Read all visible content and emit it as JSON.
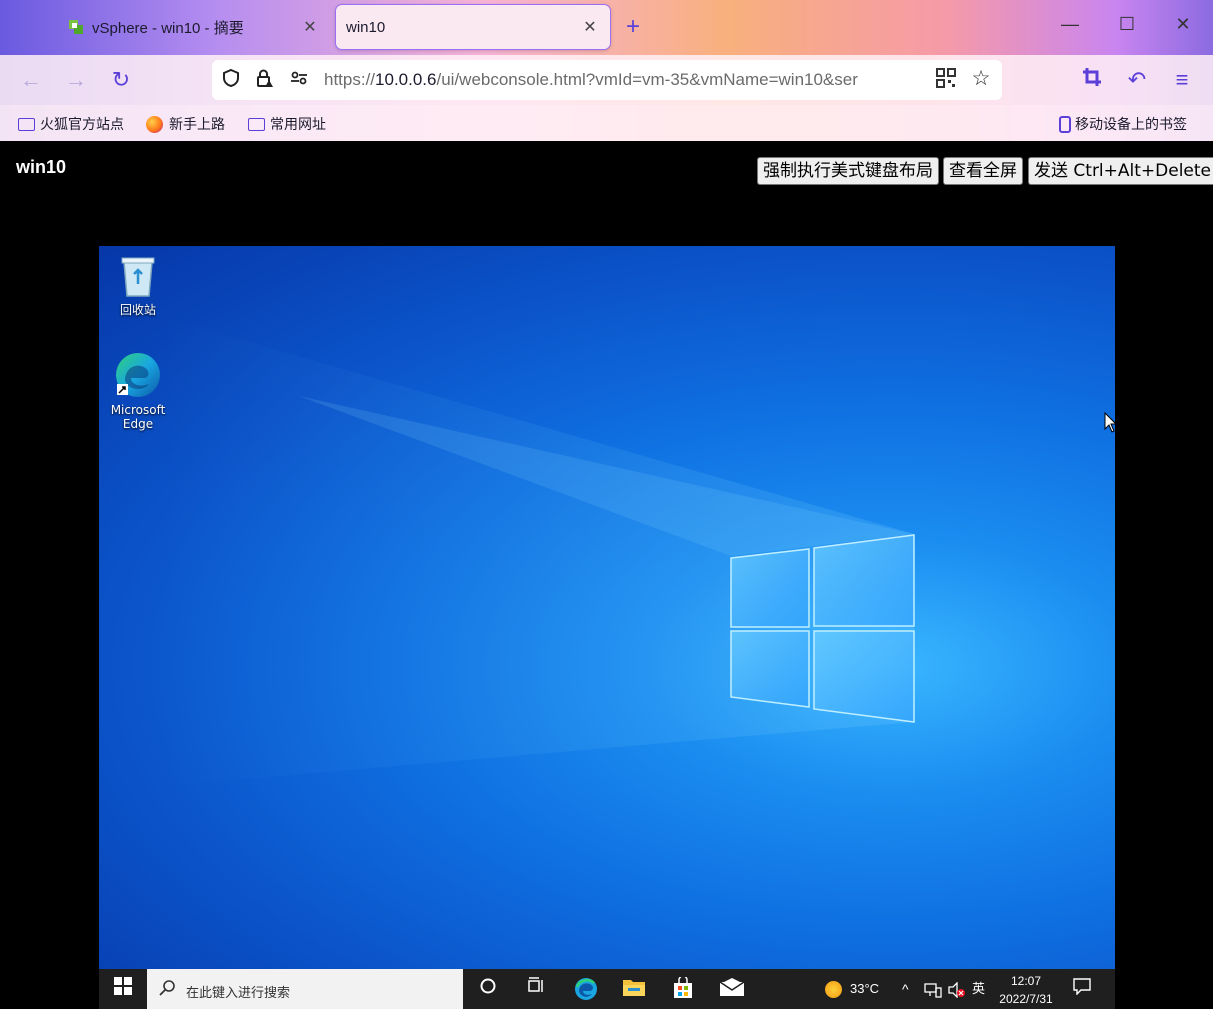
{
  "browser": {
    "tabs": [
      {
        "label": "vSphere - win10 - 摘要",
        "active": false
      },
      {
        "label": "win10",
        "active": true
      }
    ],
    "url": {
      "prefix": "https://",
      "host": "10.0.0.6",
      "path": "/ui/webconsole.html?vmId=vm-35&vmName=win10&ser"
    },
    "bookmarks": [
      {
        "label": "火狐官方站点",
        "icon": "folder-icon"
      },
      {
        "label": "新手上路",
        "icon": "firefox-icon"
      },
      {
        "label": "常用网址",
        "icon": "folder-icon"
      }
    ],
    "mobile_bookmarks": "移动设备上的书签"
  },
  "console": {
    "vm_name": "win10",
    "buttons": {
      "keyboard": "强制执行美式键盘布局",
      "fullscreen": "查看全屏",
      "cad": "发送 Ctrl+Alt+Delete"
    }
  },
  "desktop": {
    "icons": [
      {
        "label": "回收站",
        "icon": "recycle-bin-icon"
      },
      {
        "label": "Microsoft Edge",
        "icon": "edge-icon"
      }
    ],
    "taskbar": {
      "search_placeholder": "在此键入进行搜索",
      "weather": "33°C",
      "ime": "英",
      "time": "12:07",
      "date": "2022/7/31"
    }
  },
  "colors": {
    "accent": "#5b3fd8",
    "desktop_blue": "#0f6fe0",
    "taskbar": "#1f1f1f"
  }
}
